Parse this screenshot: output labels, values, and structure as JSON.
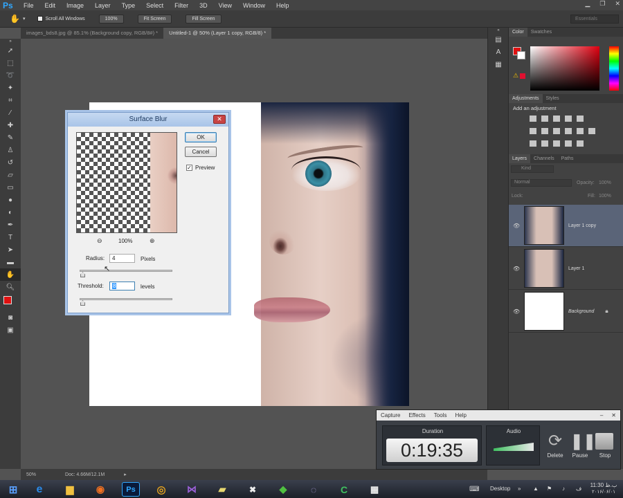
{
  "menubar": {
    "logo": "Ps",
    "items": [
      "File",
      "Edit",
      "Image",
      "Layer",
      "Type",
      "Select",
      "Filter",
      "3D",
      "View",
      "Window",
      "Help"
    ]
  },
  "options": {
    "scroll_all": "Scroll All Windows",
    "zoom_btn": "100%",
    "fit_screen": "Fit Screen",
    "fill_screen": "Fill Screen",
    "workspace": "Essentials"
  },
  "tabs": [
    {
      "label": "images_bds8.jpg @ 85.1% (Background copy, RGB/8#) *"
    },
    {
      "label": "Untitled-1 @ 50% (Layer 1 copy, RGB/8) *"
    }
  ],
  "dialog": {
    "title": "Surface Blur",
    "ok": "OK",
    "cancel": "Cancel",
    "preview": "Preview",
    "zoom": "100%",
    "radius_label": "Radius:",
    "radius_value": "4",
    "radius_unit": "Pixels",
    "threshold_label": "Threshold:",
    "threshold_value": "8",
    "threshold_unit": "levels"
  },
  "panels": {
    "color_tab": "Color",
    "swatches_tab": "Swatches",
    "adjustments_tab": "Adjustments",
    "styles_tab": "Styles",
    "add_adjustment": "Add an adjustment",
    "layers_tab": "Layers",
    "channels_tab": "Channels",
    "paths_tab": "Paths",
    "kind": "Kind",
    "blend": "Normal",
    "opacity_label": "Opacity:",
    "opacity_value": "100%",
    "lock_label": "Lock:",
    "fill_label": "Fill:",
    "fill_value": "100%"
  },
  "layers": [
    {
      "name": "Layer 1 copy"
    },
    {
      "name": "Layer 1"
    },
    {
      "name": "Background"
    }
  ],
  "status": {
    "zoom": "50%",
    "doc": "Doc: 4.66M/12.1M"
  },
  "recorder": {
    "menu": [
      "Capture",
      "Effects",
      "Tools",
      "Help"
    ],
    "duration_label": "Duration",
    "time": "0:19:35",
    "audio_label": "Audio",
    "delete": "Delete",
    "pause": "Pause",
    "stop": "Stop"
  },
  "taskbar": {
    "desktop": "Desktop",
    "time": "11:30 ب.ظ",
    "date": "۲۰۱۶/۰۶/۰۱"
  },
  "colors": {
    "foreground": "#e01010",
    "accent": "#31a8ff"
  }
}
